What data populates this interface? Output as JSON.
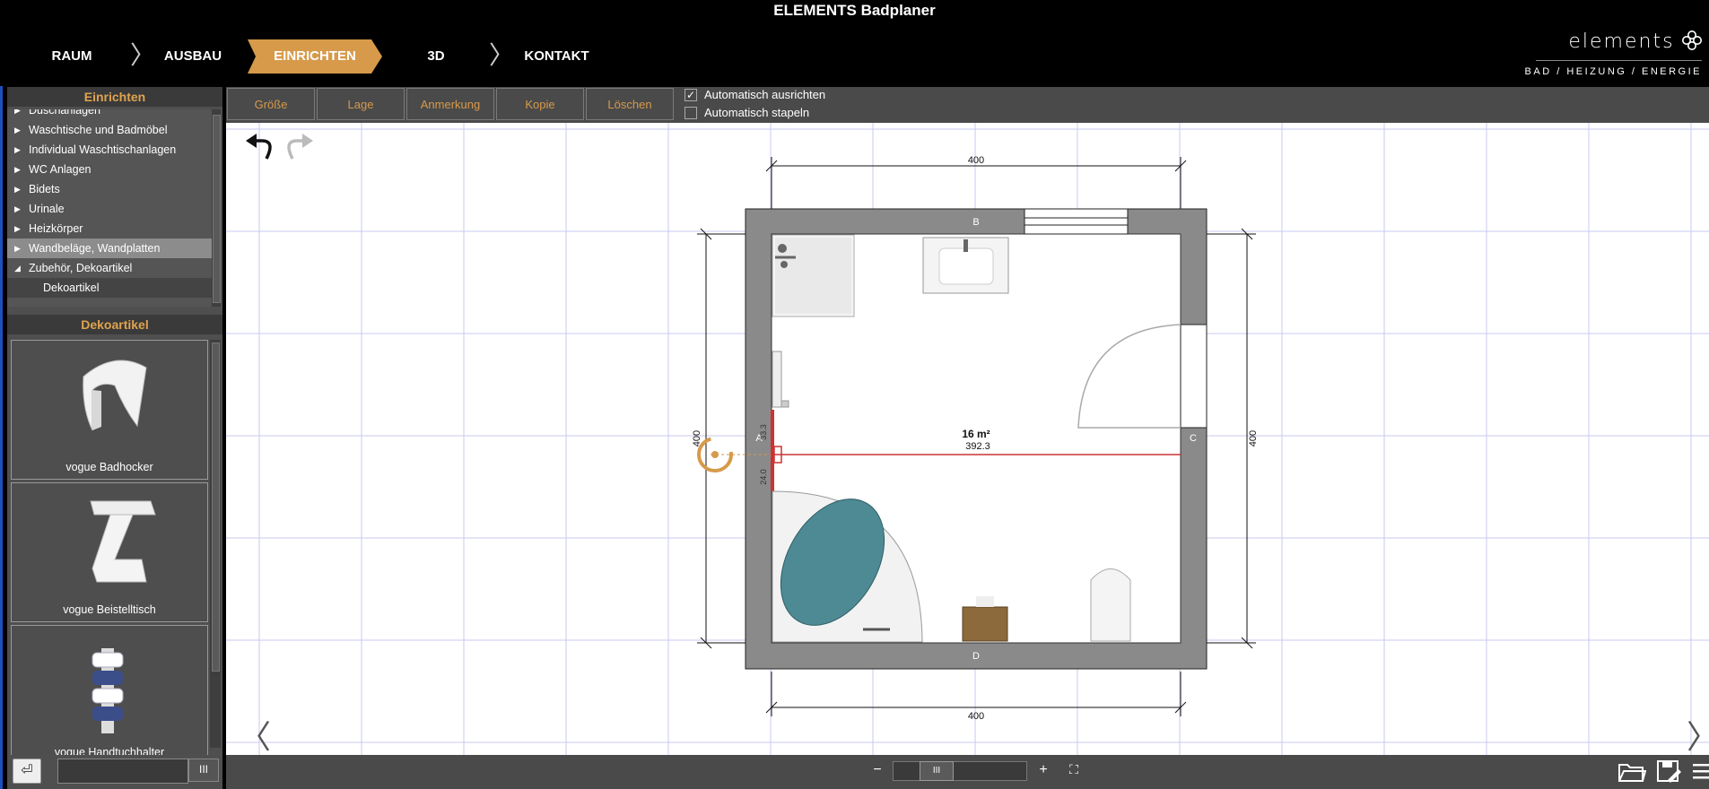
{
  "app": {
    "title": "ELEMENTS Badplaner"
  },
  "steps": [
    {
      "label": "RAUM"
    },
    {
      "label": "AUSBAU"
    },
    {
      "label": "EINRICHTEN"
    },
    {
      "label": "3D"
    },
    {
      "label": "KONTAKT"
    }
  ],
  "brand": {
    "name": "elements",
    "tagline": "BAD / HEIZUNG / ENERGIE"
  },
  "left": {
    "panel1_title": "Einrichten",
    "categories": [
      {
        "label": "Duschanlagen"
      },
      {
        "label": "Waschtische und Badmöbel"
      },
      {
        "label": "Individual Waschtischanlagen"
      },
      {
        "label": "WC Anlagen"
      },
      {
        "label": "Bidets"
      },
      {
        "label": "Urinale"
      },
      {
        "label": "Heizkörper"
      },
      {
        "label": "Wandbeläge, Wandplatten"
      },
      {
        "label": "Zubehör, Dekoartikel"
      },
      {
        "label": "Dekoartikel"
      }
    ],
    "panel2_title": "Dekoartikel",
    "products": [
      {
        "label": "vogue Badhocker"
      },
      {
        "label": "vogue Beistelltisch"
      },
      {
        "label": "vogue Handtuchhalter"
      }
    ]
  },
  "toolbar": {
    "buttons": [
      {
        "label": "Größe"
      },
      {
        "label": "Lage"
      },
      {
        "label": "Anmerkung"
      },
      {
        "label": "Kopie"
      },
      {
        "label": "Löschen"
      }
    ],
    "auto_align": {
      "label": "Automatisch ausrichten",
      "checked": true
    },
    "auto_stack": {
      "label": "Automatisch stapeln",
      "checked": false
    }
  },
  "plan": {
    "dim_top": "400",
    "dim_bottom": "400",
    "dim_left": "400",
    "dim_right": "400",
    "wall_a": "A",
    "wall_b": "B",
    "wall_c": "C",
    "wall_d": "D",
    "area": "16 m²",
    "measure": "392.3",
    "measure_up": "33.3",
    "measure_down": "24.0"
  },
  "bottom": {
    "zoom_out": "−",
    "zoom_in": "+",
    "fit": "⛶",
    "thumb": "III"
  }
}
